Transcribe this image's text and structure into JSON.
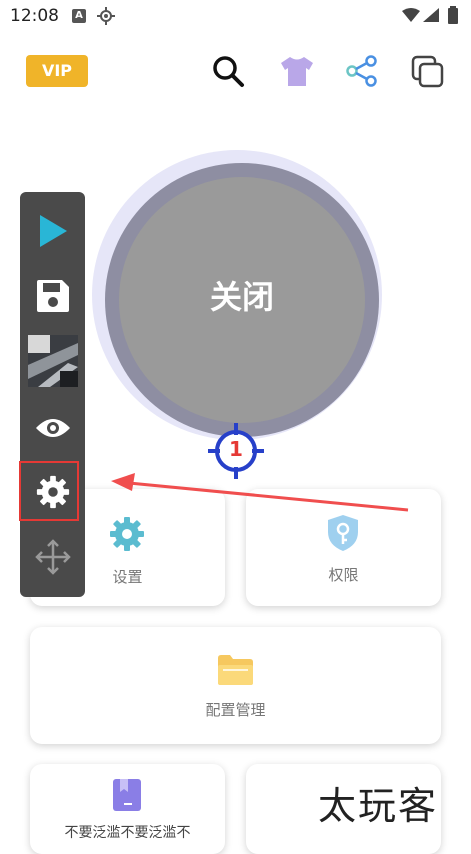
{
  "status_bar": {
    "time": "12:08",
    "badge": "A"
  },
  "header": {
    "vip_label": "VIP",
    "icons": [
      "search-icon",
      "tshirt-icon",
      "share-icon",
      "copy-icon"
    ]
  },
  "main": {
    "toggle_label": "关闭",
    "target_number": "1"
  },
  "cards": {
    "settings_label": "设置",
    "permission_label": "权限",
    "config_label": "配置管理",
    "bottom_left_label": "不要泛滥不要泛滥不"
  },
  "toolbar": {
    "items": [
      "play-icon",
      "save-icon",
      "thumbnail",
      "eye-icon",
      "gear-icon",
      "move-icon"
    ]
  },
  "watermark": "太玩客",
  "colors": {
    "vip": "#f0b429",
    "accent_blue": "#2196f3",
    "highlight_red": "#e53935",
    "toolbar_bg": "#4a4a4a"
  }
}
